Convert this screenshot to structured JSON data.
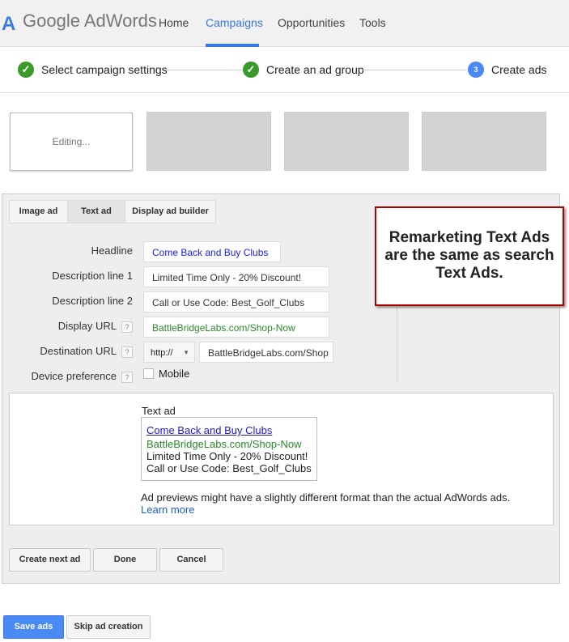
{
  "header": {
    "logo_mark": "A",
    "logo": "Google AdWords",
    "nav": [
      "Home",
      "Campaigns",
      "Opportunities",
      "Tools"
    ],
    "active": "Campaigns"
  },
  "steps": [
    {
      "label": "Select campaign settings",
      "status": "done"
    },
    {
      "label": "Create an ad group",
      "status": "done"
    },
    {
      "label": "Create ads",
      "number": "3",
      "status": "current"
    }
  ],
  "thumbs": {
    "editing": "Editing..."
  },
  "tabs": [
    "Image ad",
    "Text ad",
    "Display ad builder"
  ],
  "form": {
    "headline_label": "Headline",
    "headline": "Come Back and Buy Clubs",
    "desc1_label": "Description line 1",
    "desc1": "Limited Time Only - 20% Discount!",
    "desc2_label": "Description line 2",
    "desc2": "Call or Use Code: Best_Golf_Clubs",
    "display_url_label": "Display URL",
    "display_url": "BattleBridgeLabs.com/Shop-Now",
    "dest_url_label": "Destination URL",
    "protocol": "http://",
    "dest_url": "BattleBridgeLabs.com/Shop",
    "device_label": "Device preference",
    "mobile": "Mobile",
    "help": "?"
  },
  "callout": "Remarketing Text Ads are the same as search Text Ads.",
  "preview": {
    "title": "Text ad",
    "headline": "Come Back and Buy Clubs",
    "url": "BattleBridgeLabs.com/Shop-Now",
    "line1": "Limited Time Only - 20% Discount!",
    "line2": "Call or Use Code: Best_Golf_Clubs",
    "note": "Ad previews might have a slightly different format than the actual AdWords ads.",
    "learn_more": "Learn more"
  },
  "buttons": {
    "create_next": "Create next ad",
    "done": "Done",
    "cancel": "Cancel",
    "save": "Save ads",
    "skip": "Skip ad creation"
  }
}
